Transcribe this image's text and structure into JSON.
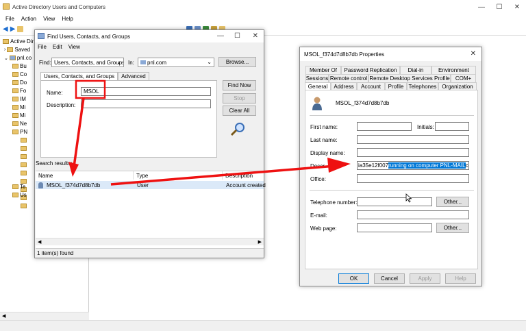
{
  "main": {
    "title": "Active Directory Users and Computers",
    "menu": [
      "File",
      "Action",
      "View",
      "Help"
    ],
    "tree": [
      "Active Dir",
      "Saved",
      "pnl.co",
      "Bu",
      "Co",
      "Do",
      "Fo",
      "IM",
      "Mi",
      "Mi",
      "Ne",
      "PN",
      "",
      "",
      "",
      "",
      "",
      "",
      "",
      "",
      "",
      "Te",
      "Us"
    ]
  },
  "find": {
    "title": "Find Users, Contacts, and Groups",
    "menu": [
      "File",
      "Edit",
      "View"
    ],
    "find_label": "Find:",
    "find_value": "Users, Contacts, and Groups",
    "in_label": "In:",
    "in_value": "pnl.com",
    "browse": "Browse...",
    "tabs": [
      "Users, Contacts, and Groups",
      "Advanced"
    ],
    "name_label": "Name:",
    "name_value": "MSOL",
    "desc_label": "Description:",
    "desc_value": "",
    "find_now": "Find Now",
    "stop": "Stop",
    "clear_all": "Clear All",
    "search_results": "Search results:",
    "columns": [
      "Name",
      "Type",
      "Description"
    ],
    "rows": [
      {
        "name": "MSOL_f374d7d8b7db",
        "type": "User",
        "description": "Account created"
      }
    ],
    "status": "1 item(s) found"
  },
  "props": {
    "title": "MSOL_f374d7d8b7db Properties",
    "tabs_row1": [
      "Member Of",
      "Password Replication",
      "Dial-in",
      "Environment"
    ],
    "tabs_row2": [
      "Sessions",
      "Remote control",
      "Remote Desktop Services Profile",
      "COM+"
    ],
    "tabs_row3": [
      "General",
      "Address",
      "Account",
      "Profile",
      "Telephones",
      "Organization"
    ],
    "user_name": "MSOL_f374d7d8b7db",
    "first_name_label": "First name:",
    "initials_label": "Initials:",
    "last_name_label": "Last name:",
    "display_name_label": "Display name:",
    "description_label": "Descr",
    "description_pre": "ia35e12f007",
    "description_selected": "running on computer PNL-MAIL",
    "description_post": "configu",
    "office_label": "Office:",
    "telephone_label": "Telephone number:",
    "email_label": "E-mail:",
    "webpage_label": "Web page:",
    "other": "Other...",
    "ok": "OK",
    "cancel": "Cancel",
    "apply": "Apply",
    "help": "Help"
  },
  "colors": {
    "annotation": "#ee1111",
    "selection": "#0078d7"
  }
}
